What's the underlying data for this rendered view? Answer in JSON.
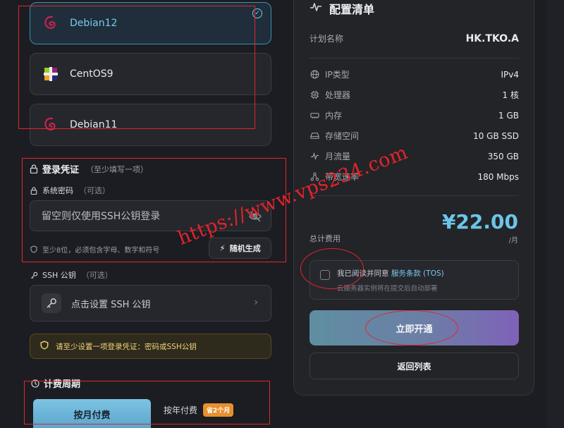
{
  "os_list": [
    {
      "label": "Debian12",
      "selected": true,
      "icon": "debian-icon"
    },
    {
      "label": "CentOS9",
      "selected": false,
      "icon": "centos-icon"
    },
    {
      "label": "Debian11",
      "selected": false,
      "icon": "debian-icon"
    }
  ],
  "login": {
    "title": "登录凭证",
    "title_hint": "（至少填写一项）",
    "password_label": "系统密码",
    "password_hint": "（可选）",
    "password_placeholder": "留空则仅使用SSH公钥登录",
    "password_note": "至少8位，必须包含字母、数字和符号",
    "generate_label": "随机生成",
    "ssh_label": "SSH 公钥",
    "ssh_hint": "（可选）",
    "ssh_action": "点击设置 SSH 公钥",
    "warning": "请至少设置一项登录凭证：密码或SSH公钥"
  },
  "billing": {
    "title": "计费周期",
    "monthly": "按月付费",
    "yearly": "按年付费",
    "yearly_badge": "省2个月"
  },
  "summary": {
    "title": "配置清单",
    "plan_key": "计划名称",
    "plan_value": "HK.TKO.A",
    "specs": [
      {
        "key": "IP类型",
        "value": "IPv4",
        "icon": "globe-icon"
      },
      {
        "key": "处理器",
        "value": "1 核",
        "icon": "cpu-icon"
      },
      {
        "key": "内存",
        "value": "1 GB",
        "icon": "memory-icon"
      },
      {
        "key": "存储空间",
        "value": "10 GB SSD",
        "icon": "disk-icon"
      },
      {
        "key": "月流量",
        "value": "350 GB",
        "icon": "traffic-icon"
      },
      {
        "key": "带宽速率",
        "value": "180 Mbps",
        "icon": "network-icon"
      }
    ],
    "price": "¥22.00",
    "per": "/月",
    "total_label": "总计费用",
    "tos_prefix": "我已阅读并同意 ",
    "tos_link": "服务条款 (TOS)",
    "tos_note": "云服务器实例将在提交后自动部署",
    "open_button": "立即开通",
    "back_button": "返回列表"
  },
  "watermark": "https://www.vps234.com",
  "colors": {
    "accent": "#6cc5e8",
    "annotation": "#e0262c",
    "warning": "#f2d27a"
  }
}
